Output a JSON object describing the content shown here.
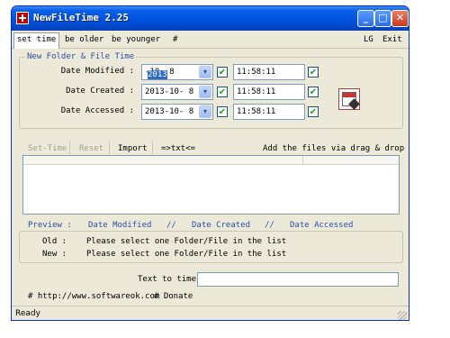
{
  "window": {
    "title": "NewFileTime 2.25"
  },
  "titlebar": {
    "min_glyph": "_",
    "max_glyph": "□",
    "close_glyph": "✕"
  },
  "menu": {
    "items": [
      "set time",
      "be older",
      "be younger",
      "#"
    ],
    "right": [
      "LG",
      "Exit"
    ]
  },
  "group": {
    "label": "New Folder & File Time",
    "rows": [
      {
        "label": "Date Modified :",
        "date_selected": "2013",
        "date_rest": "-10- 8",
        "time": "11:58:11"
      },
      {
        "label": "Date Created :",
        "date_selected": "",
        "date_rest": "2013-10- 8",
        "time": "11:58:11"
      },
      {
        "label": "Date Accessed :",
        "date_selected": "",
        "date_rest": "2013-10- 8",
        "time": "11:58:11"
      }
    ],
    "check_glyph": "✔",
    "dropdown_glyph": "▾"
  },
  "toolbar": {
    "set_time": "Set-Time",
    "reset": "Reset",
    "import": "Import",
    "txt": "=>txt<=",
    "drag_hint": "Add the files via drag & drop ▾"
  },
  "preview": {
    "header": [
      "Preview :",
      "Date Modified",
      "//",
      "Date Created",
      "//",
      "Date Accessed"
    ],
    "old_label": "Old :",
    "old_value": "Please select one Folder/File in the list",
    "new_label": "New :",
    "new_value": "Please select one Folder/File in the list"
  },
  "text_to_time": {
    "label": "Text to time",
    "value": ""
  },
  "links": {
    "website": "# http://www.softwareok.com",
    "donate": "# Donate"
  },
  "status": {
    "text": "Ready"
  },
  "colors": {
    "accent": "#2c4fa8",
    "titlebar": "#0054e3",
    "check": "#21a121"
  }
}
